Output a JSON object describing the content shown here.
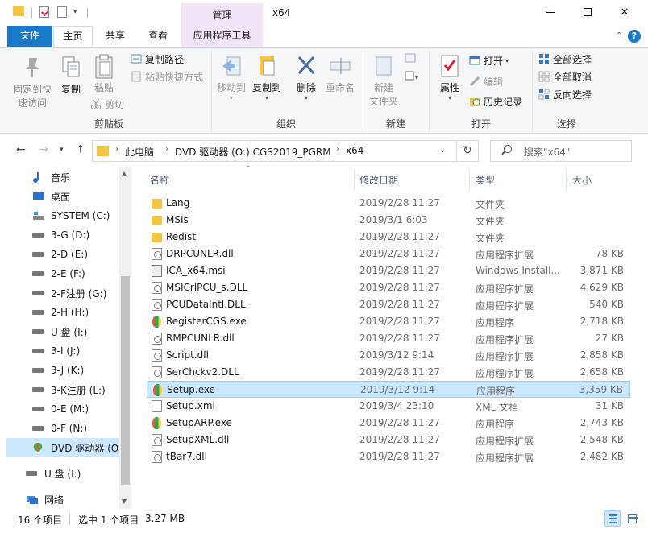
{
  "window": {
    "title": "x64",
    "context_tab": "管理"
  },
  "tabs": {
    "file": "文件",
    "home": "主页",
    "share": "共享",
    "view": "查看",
    "app_tools": "应用程序工具"
  },
  "help_label": "?",
  "ribbon": {
    "clipboard": {
      "label": "剪贴板",
      "pin": "固定到快速访问",
      "pin_line1": "固定到快",
      "pin_line2": "速访问",
      "copy": "复制",
      "paste": "粘贴",
      "copy_path": "复制路径",
      "paste_shortcut": "粘贴快捷方式",
      "cut": "剪切"
    },
    "organize": {
      "label": "组织",
      "move_to": "移动到",
      "copy_to": "复制到",
      "delete": "删除",
      "rename": "重命名"
    },
    "new": {
      "label": "新建",
      "new_folder_line1": "新建",
      "new_folder_line2": "文件夹"
    },
    "open": {
      "label": "打开",
      "properties": "属性",
      "open": "打开",
      "edit": "编辑",
      "history": "历史记录"
    },
    "select": {
      "label": "选择",
      "select_all": "全部选择",
      "select_none": "全部取消",
      "invert": "反向选择"
    }
  },
  "address": {
    "crumbs": [
      "此电脑",
      "DVD 驱动器 (O:) CGS2019_PGRM",
      "x64"
    ],
    "search_placeholder": "搜索\"x64\""
  },
  "nav": [
    {
      "label": "音乐",
      "icon": "music-icon"
    },
    {
      "label": "桌面",
      "icon": "desktop-icon"
    },
    {
      "label": "SYSTEM (C:)",
      "icon": "system-drive-icon"
    },
    {
      "label": "3-G (D:)",
      "icon": "drive-icon"
    },
    {
      "label": "2-D (E:)",
      "icon": "drive-icon"
    },
    {
      "label": "2-E (F:)",
      "icon": "drive-icon"
    },
    {
      "label": "2-F注册 (G:)",
      "icon": "drive-icon"
    },
    {
      "label": "2-H (H:)",
      "icon": "drive-icon"
    },
    {
      "label": "U 盘 (I:)",
      "icon": "usb-drive-icon"
    },
    {
      "label": "3-I (J:)",
      "icon": "drive-icon"
    },
    {
      "label": "3-J (K:)",
      "icon": "drive-icon"
    },
    {
      "label": "3-K注册 (L:)",
      "icon": "drive-icon"
    },
    {
      "label": "0-E (M:)",
      "icon": "drive-icon"
    },
    {
      "label": "0-F (N:)",
      "icon": "drive-icon"
    },
    {
      "label": "DVD 驱动器 (O:",
      "icon": "dvd-icon"
    },
    {
      "label": "U 盘 (I:)",
      "icon": "usb-drive-icon"
    },
    {
      "label": "网络",
      "icon": "network-icon"
    }
  ],
  "columns": {
    "name": "名称",
    "date": "修改日期",
    "type": "类型",
    "size": "大小"
  },
  "files": [
    {
      "name": "Lang",
      "date": "2019/2/28 11:27",
      "type": "文件夹",
      "size": "",
      "icon": "folder"
    },
    {
      "name": "MSIs",
      "date": "2019/3/1 6:03",
      "type": "文件夹",
      "size": "",
      "icon": "folder"
    },
    {
      "name": "Redist",
      "date": "2019/2/28 11:27",
      "type": "文件夹",
      "size": "",
      "icon": "folder"
    },
    {
      "name": "DRPCUNLR.dll",
      "date": "2019/2/28 11:27",
      "type": "应用程序扩展",
      "size": "78 KB",
      "icon": "dll"
    },
    {
      "name": "ICA_x64.msi",
      "date": "2019/2/28 11:27",
      "type": "Windows Install...",
      "size": "3,871 KB",
      "icon": "msi"
    },
    {
      "name": "MSICrlPCU_s.DLL",
      "date": "2019/2/28 11:27",
      "type": "应用程序扩展",
      "size": "4,629 KB",
      "icon": "dll"
    },
    {
      "name": "PCUDataIntl.DLL",
      "date": "2019/2/28 11:27",
      "type": "应用程序扩展",
      "size": "540 KB",
      "icon": "dll"
    },
    {
      "name": "RegisterCGS.exe",
      "date": "2019/2/28 11:27",
      "type": "应用程序",
      "size": "2,718 KB",
      "icon": "exe"
    },
    {
      "name": "RMPCUNLR.dll",
      "date": "2019/2/28 11:27",
      "type": "应用程序扩展",
      "size": "27 KB",
      "icon": "dll"
    },
    {
      "name": "Script.dll",
      "date": "2019/3/12 9:14",
      "type": "应用程序扩展",
      "size": "2,858 KB",
      "icon": "dll"
    },
    {
      "name": "SerChckv2.DLL",
      "date": "2019/2/28 11:27",
      "type": "应用程序扩展",
      "size": "2,658 KB",
      "icon": "dll"
    },
    {
      "name": "Setup.exe",
      "date": "2019/3/12 9:14",
      "type": "应用程序",
      "size": "3,359 KB",
      "icon": "exe",
      "selected": true
    },
    {
      "name": "Setup.xml",
      "date": "2019/3/4 23:10",
      "type": "XML 文档",
      "size": "31 KB",
      "icon": "xml"
    },
    {
      "name": "SetupARP.exe",
      "date": "2019/2/28 11:27",
      "type": "应用程序",
      "size": "2,743 KB",
      "icon": "exe"
    },
    {
      "name": "SetupXML.dll",
      "date": "2019/2/28 11:27",
      "type": "应用程序扩展",
      "size": "2,548 KB",
      "icon": "dll"
    },
    {
      "name": "tBar7.dll",
      "date": "2019/2/28 11:27",
      "type": "应用程序扩展",
      "size": "2,482 KB",
      "icon": "dll"
    }
  ],
  "status": {
    "count": "16 个项目",
    "selection": "选中 1 个项目",
    "size": "3.27 MB"
  },
  "colors": {
    "accent": "#1979ca",
    "selection": "#cce8ff",
    "context_tab": "#f1e4f7",
    "folder": "#f4c542"
  }
}
